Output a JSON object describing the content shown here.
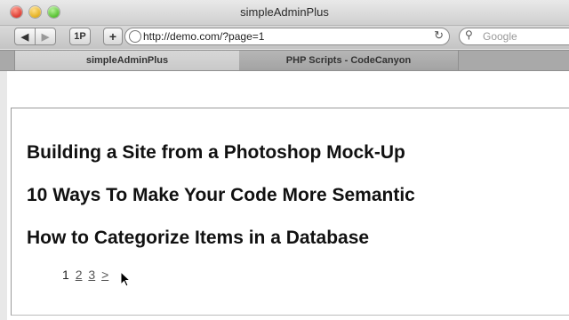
{
  "window": {
    "title": "simpleAdminPlus"
  },
  "toolbar": {
    "onep_label": "1P",
    "plus_label": "+",
    "back_label": "◀",
    "forward_label": "▶",
    "url": "http://demo.com/?page=1",
    "search_placeholder": "Google"
  },
  "tabs": [
    {
      "label": "simpleAdminPlus",
      "active": true
    },
    {
      "label": "PHP Scripts - CodeCanyon",
      "active": false
    }
  ],
  "posts": [
    "Building a Site from a Photoshop Mock-Up",
    "10 Ways To Make Your Code More Semantic",
    "How to Categorize Items in a Database"
  ],
  "pagination": {
    "current": "1",
    "links": [
      "2",
      "3",
      ">"
    ]
  }
}
